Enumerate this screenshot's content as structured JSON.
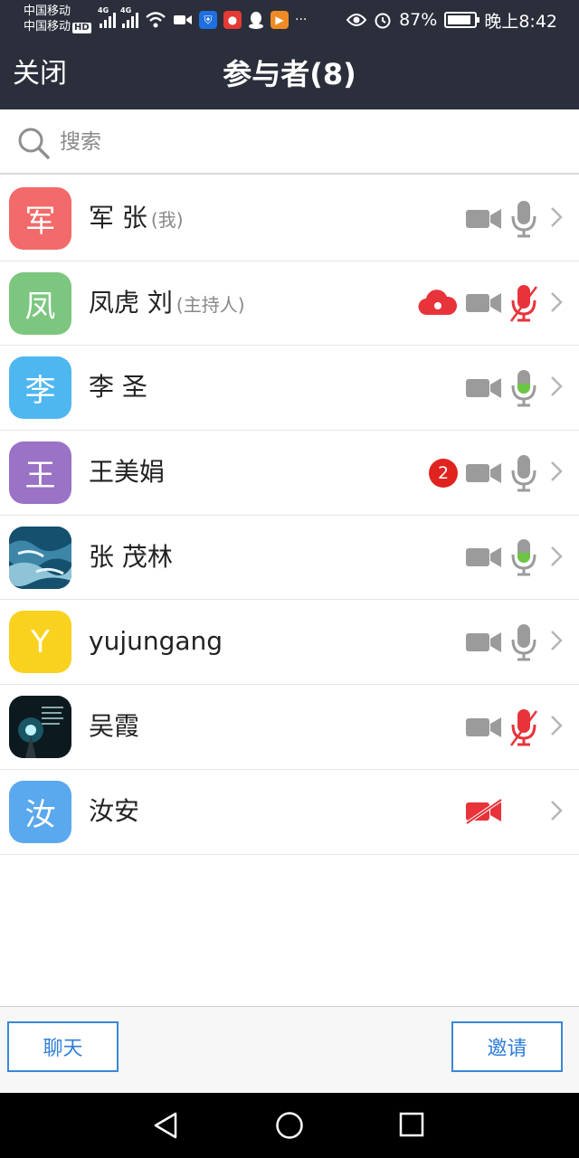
{
  "status_bar": {
    "carrier1": "中国移动",
    "carrier2": "中国移动",
    "hd": "HD",
    "net1": "4G",
    "net2": "4G",
    "battery": "87%",
    "battery_level": 0.87,
    "time": "晚上8:42",
    "ellipsis": "···"
  },
  "header": {
    "close_label": "关闭",
    "title": "参与者(8)"
  },
  "search": {
    "placeholder": "搜索",
    "value": ""
  },
  "participants": [
    {
      "initial": "军",
      "avatar_color": "#f26a6a",
      "name": "军 张",
      "role": "(我)",
      "cloud": false,
      "badge": "",
      "video_off": false,
      "mic": "idle"
    },
    {
      "initial": "凤",
      "avatar_color": "#7cc67f",
      "name": "凤虎 刘",
      "role": "(主持人)",
      "cloud": true,
      "badge": "",
      "video_off": false,
      "mic": "muted"
    },
    {
      "initial": "李",
      "avatar_color": "#4fb7f0",
      "name": "李 圣",
      "role": "",
      "cloud": false,
      "badge": "",
      "video_off": false,
      "mic": "active"
    },
    {
      "initial": "王",
      "avatar_color": "#9a72c6",
      "name": "王美娟",
      "role": "",
      "cloud": false,
      "badge": "2",
      "video_off": false,
      "mic": "idle"
    },
    {
      "initial": "",
      "avatar_color": "#1b4f6b",
      "avatar_photo": "ocean",
      "name": "张 茂林",
      "role": "",
      "cloud": false,
      "badge": "",
      "video_off": false,
      "mic": "active"
    },
    {
      "initial": "Y",
      "avatar_color": "#f8d21f",
      "name": "yujungang",
      "role": "",
      "cloud": false,
      "badge": "",
      "video_off": false,
      "mic": "idle"
    },
    {
      "initial": "",
      "avatar_color": "#0d1d24",
      "avatar_photo": "night",
      "name": "吴霞",
      "role": "",
      "cloud": false,
      "badge": "",
      "video_off": false,
      "mic": "muted"
    },
    {
      "initial": "汝",
      "avatar_color": "#5aa8ee",
      "name": "汝安",
      "role": "",
      "cloud": false,
      "badge": "",
      "video_off": true,
      "mic": "none"
    }
  ],
  "footer": {
    "chat_label": "聊天",
    "invite_label": "邀请"
  },
  "colors": {
    "header_bg": "#2b2f3c",
    "accent_blue": "#2f7ed8",
    "muted_red": "#e8333a",
    "active_green": "#6cc644",
    "icon_gray": "#9b9b9b"
  }
}
